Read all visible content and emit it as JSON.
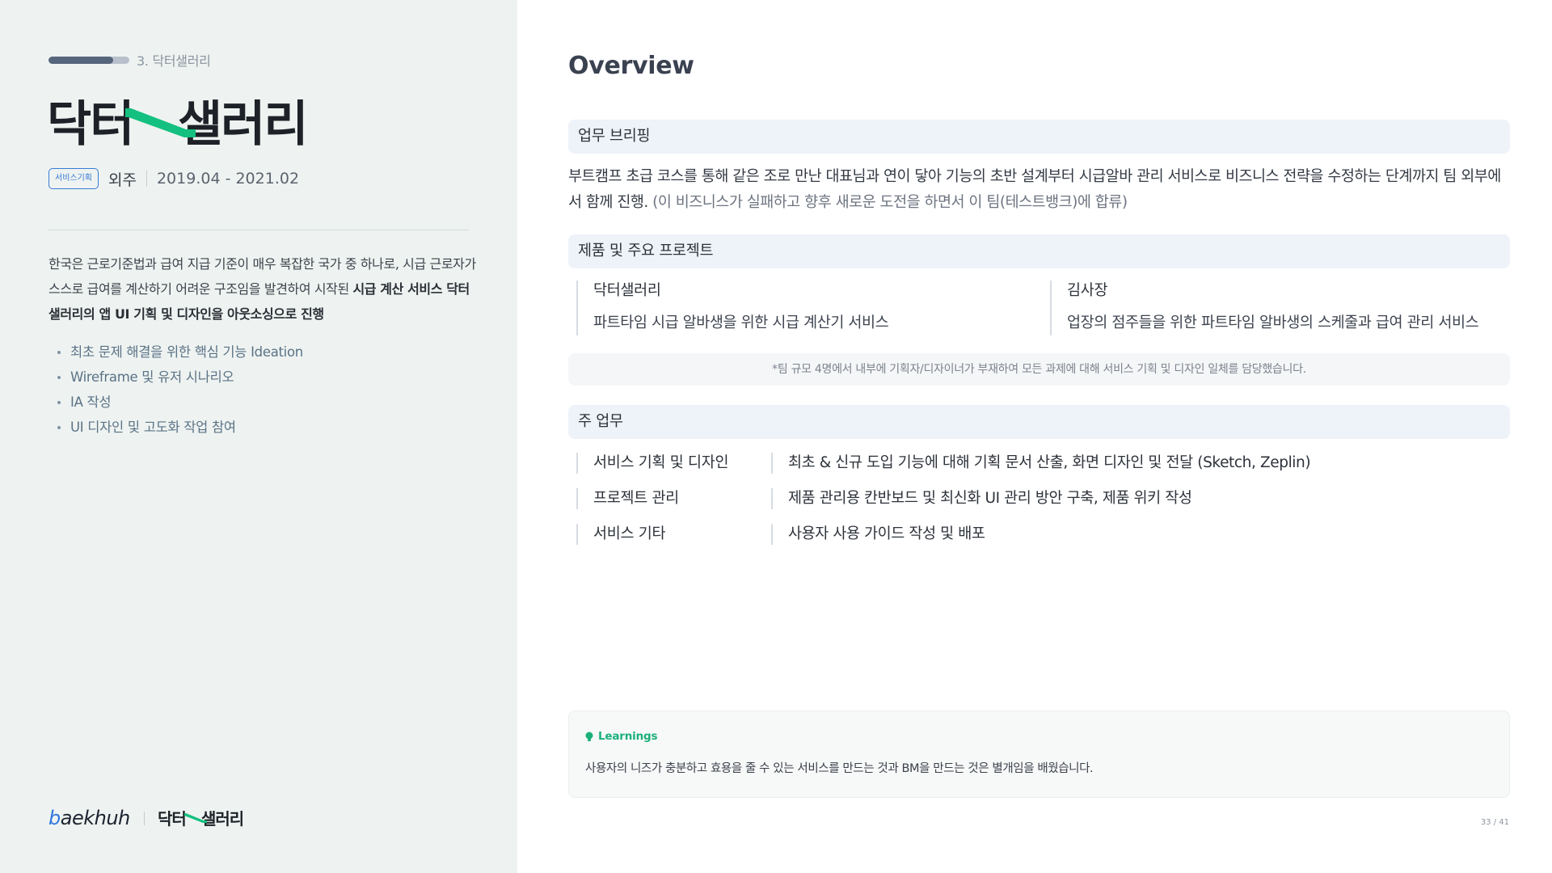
{
  "left": {
    "chapter_label": "3. 닥터샐러리",
    "progress": 0.8,
    "logo_text": {
      "part1": "닥터",
      "part2": "샐러리"
    },
    "tag": "서비스기획",
    "type": "외주",
    "period": "2019.04 - 2021.02",
    "intro": {
      "text1": "한국은 근로기준법과 급여 지급 기준이 매우 복잡한 국가 중 하나로, 시급 근로자가 스스로 급여를 계산하기 어려운 구조임을 발견하여 시작된 ",
      "text_bold": "시급 계산 서비스 닥터샐러리의 앱 UI 기획 및 디자인을 아웃소싱으로 진행"
    },
    "bullets": [
      "최초 문제 해결을 위한 핵심 기능 Ideation",
      "Wireframe 및 유저 시나리오",
      "IA 작성",
      "UI 디자인 및 고도화 작업 참여"
    ],
    "footer": {
      "brand_b": "b",
      "brand_rest": "aekhuh",
      "logo_part1": "닥터",
      "logo_part2": "샐러리"
    }
  },
  "main": {
    "title": "Overview",
    "briefing": {
      "heading": "업무 브리핑",
      "text": "부트캠프 초급 코스를 통해 같은 조로 만난 대표님과 연이 닿아 기능의 초반 설계부터 시급알바 관리 서비스로 비즈니스 전략을 수정하는 단계까지 팀 외부에서 함께 진행. ",
      "note": "(이 비즈니스가 실패하고 향후 새로운 도전을 하면서 이 팀(테스트뱅크)에 합류)"
    },
    "products": {
      "heading": "제품 및 주요 프로젝트",
      "items": [
        {
          "name": "닥터샐러리",
          "desc": "파트타임 시급 알바생을 위한 시급 계산기 서비스"
        },
        {
          "name": "김사장",
          "desc": "업장의 점주들을 위한 파트타임 알바생의 스케줄과 급여 관리 서비스"
        }
      ],
      "note": "*팀 규모 4명에서 내부에 기획자/디자이너가 부재하여 모든 과제에 대해 서비스 기획 및 디자인 일체를 담당했습니다."
    },
    "tasks": {
      "heading": "주 업무",
      "rows": [
        {
          "label": "서비스 기획 및 디자인",
          "desc": "최초 & 신규 도입 기능에 대해 기획 문서 산출, 화면 디자인 및 전달 (Sketch, Zeplin)"
        },
        {
          "label": "프로젝트 관리",
          "desc": "제품 관리용 칸반보드 및 최신화 UI 관리 방안 구축, 제품 위키 작성"
        },
        {
          "label": "서비스 기타",
          "desc": "사용자 사용 가이드 작성 및 배포"
        }
      ]
    },
    "learnings": {
      "title": "Learnings",
      "text": "사용자의 니즈가 충분하고 효용을 줄 수 있는 서비스를 만드는 것과 BM을 만드는 것은 별개임을 배웠습니다."
    },
    "page": "33 / 41"
  },
  "colors": {
    "accent_green": "#13c07f",
    "brand_blue": "#2f76e0",
    "left_bg": "#eef3f1",
    "section_bg": "#eef2f9"
  }
}
